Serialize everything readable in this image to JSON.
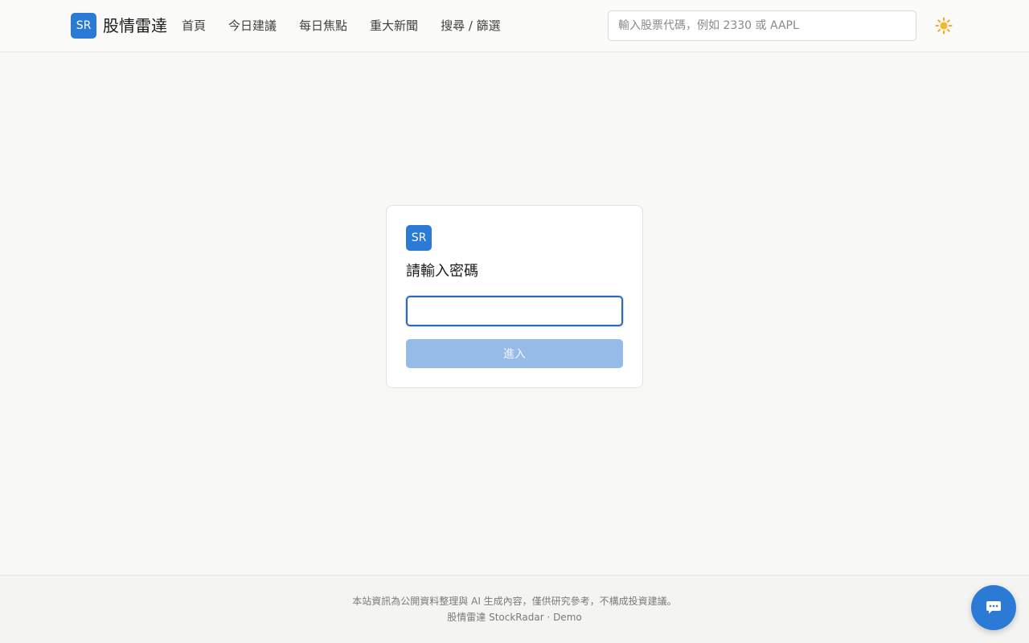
{
  "header": {
    "logo_text": "SR",
    "brand_name": "股情雷達",
    "nav": [
      {
        "label": "首頁"
      },
      {
        "label": "今日建議"
      },
      {
        "label": "每日焦點"
      },
      {
        "label": "重大新聞"
      },
      {
        "label": "搜尋 / 篩選"
      }
    ],
    "search": {
      "placeholder": "輸入股票代碼，例如 2330 或 AAPL",
      "value": ""
    },
    "theme_icon": "sun-icon"
  },
  "login_card": {
    "logo_text": "SR",
    "title": "請輸入密碼",
    "password_value": "",
    "submit_label": "進入"
  },
  "footer": {
    "disclaimer": "本站資訊為公開資料整理與 AI 生成內容，僅供研究參考，不構成投資建議。",
    "credit": "股情雷達 StockRadar · Demo"
  },
  "chat_button": {
    "icon": "chat-bubble-icon"
  },
  "colors": {
    "accent": "#2b7bd6",
    "button_disabled": "#96bbe8",
    "page_background": "#f8f8f6"
  }
}
